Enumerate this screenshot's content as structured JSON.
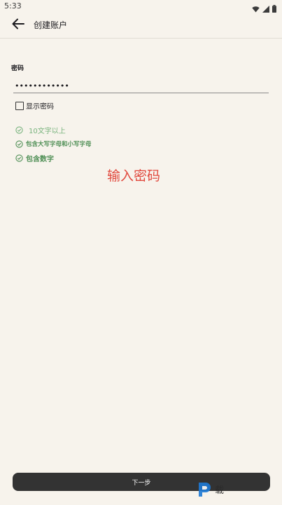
{
  "status_bar": {
    "time": "5:33",
    "icons": [
      "wifi-icon",
      "signal-icon",
      "battery-icon"
    ]
  },
  "app_bar": {
    "back_icon": "arrow-left-icon",
    "title": "创建账户"
  },
  "password_field": {
    "label": "密码",
    "value": "••••••••••••"
  },
  "show_password": {
    "label": "显示密码",
    "checked": false
  },
  "requirements": [
    {
      "text": "10文字以上",
      "icon": "check-circle-icon"
    },
    {
      "text": "包含大写字母和小写字母",
      "icon": "check-circle-icon"
    },
    {
      "text": "包含数字",
      "icon": "check-circle-icon"
    }
  ],
  "annotation": "输入密码",
  "next_button": {
    "label": "下一步"
  },
  "watermark": {
    "text": "载"
  },
  "colors": {
    "background": "#f7f3ec",
    "annotation_red": "#e14a3f",
    "check_green": "#4f8f55",
    "button_dark": "#333333"
  }
}
